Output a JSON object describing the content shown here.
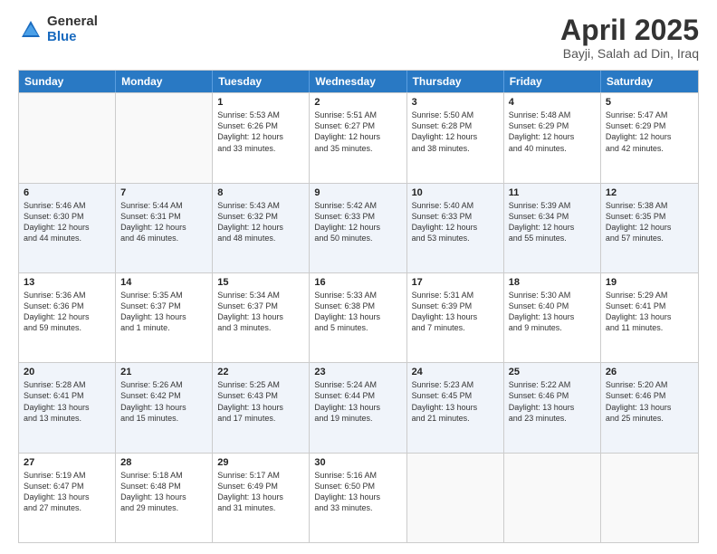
{
  "logo": {
    "general": "General",
    "blue": "Blue"
  },
  "header": {
    "title": "April 2025",
    "subtitle": "Bayji, Salah ad Din, Iraq"
  },
  "days": [
    "Sunday",
    "Monday",
    "Tuesday",
    "Wednesday",
    "Thursday",
    "Friday",
    "Saturday"
  ],
  "weeks": [
    [
      {
        "day": "",
        "lines": []
      },
      {
        "day": "",
        "lines": []
      },
      {
        "day": "1",
        "lines": [
          "Sunrise: 5:53 AM",
          "Sunset: 6:26 PM",
          "Daylight: 12 hours",
          "and 33 minutes."
        ]
      },
      {
        "day": "2",
        "lines": [
          "Sunrise: 5:51 AM",
          "Sunset: 6:27 PM",
          "Daylight: 12 hours",
          "and 35 minutes."
        ]
      },
      {
        "day": "3",
        "lines": [
          "Sunrise: 5:50 AM",
          "Sunset: 6:28 PM",
          "Daylight: 12 hours",
          "and 38 minutes."
        ]
      },
      {
        "day": "4",
        "lines": [
          "Sunrise: 5:48 AM",
          "Sunset: 6:29 PM",
          "Daylight: 12 hours",
          "and 40 minutes."
        ]
      },
      {
        "day": "5",
        "lines": [
          "Sunrise: 5:47 AM",
          "Sunset: 6:29 PM",
          "Daylight: 12 hours",
          "and 42 minutes."
        ]
      }
    ],
    [
      {
        "day": "6",
        "lines": [
          "Sunrise: 5:46 AM",
          "Sunset: 6:30 PM",
          "Daylight: 12 hours",
          "and 44 minutes."
        ]
      },
      {
        "day": "7",
        "lines": [
          "Sunrise: 5:44 AM",
          "Sunset: 6:31 PM",
          "Daylight: 12 hours",
          "and 46 minutes."
        ]
      },
      {
        "day": "8",
        "lines": [
          "Sunrise: 5:43 AM",
          "Sunset: 6:32 PM",
          "Daylight: 12 hours",
          "and 48 minutes."
        ]
      },
      {
        "day": "9",
        "lines": [
          "Sunrise: 5:42 AM",
          "Sunset: 6:33 PM",
          "Daylight: 12 hours",
          "and 50 minutes."
        ]
      },
      {
        "day": "10",
        "lines": [
          "Sunrise: 5:40 AM",
          "Sunset: 6:33 PM",
          "Daylight: 12 hours",
          "and 53 minutes."
        ]
      },
      {
        "day": "11",
        "lines": [
          "Sunrise: 5:39 AM",
          "Sunset: 6:34 PM",
          "Daylight: 12 hours",
          "and 55 minutes."
        ]
      },
      {
        "day": "12",
        "lines": [
          "Sunrise: 5:38 AM",
          "Sunset: 6:35 PM",
          "Daylight: 12 hours",
          "and 57 minutes."
        ]
      }
    ],
    [
      {
        "day": "13",
        "lines": [
          "Sunrise: 5:36 AM",
          "Sunset: 6:36 PM",
          "Daylight: 12 hours",
          "and 59 minutes."
        ]
      },
      {
        "day": "14",
        "lines": [
          "Sunrise: 5:35 AM",
          "Sunset: 6:37 PM",
          "Daylight: 13 hours",
          "and 1 minute."
        ]
      },
      {
        "day": "15",
        "lines": [
          "Sunrise: 5:34 AM",
          "Sunset: 6:37 PM",
          "Daylight: 13 hours",
          "and 3 minutes."
        ]
      },
      {
        "day": "16",
        "lines": [
          "Sunrise: 5:33 AM",
          "Sunset: 6:38 PM",
          "Daylight: 13 hours",
          "and 5 minutes."
        ]
      },
      {
        "day": "17",
        "lines": [
          "Sunrise: 5:31 AM",
          "Sunset: 6:39 PM",
          "Daylight: 13 hours",
          "and 7 minutes."
        ]
      },
      {
        "day": "18",
        "lines": [
          "Sunrise: 5:30 AM",
          "Sunset: 6:40 PM",
          "Daylight: 13 hours",
          "and 9 minutes."
        ]
      },
      {
        "day": "19",
        "lines": [
          "Sunrise: 5:29 AM",
          "Sunset: 6:41 PM",
          "Daylight: 13 hours",
          "and 11 minutes."
        ]
      }
    ],
    [
      {
        "day": "20",
        "lines": [
          "Sunrise: 5:28 AM",
          "Sunset: 6:41 PM",
          "Daylight: 13 hours",
          "and 13 minutes."
        ]
      },
      {
        "day": "21",
        "lines": [
          "Sunrise: 5:26 AM",
          "Sunset: 6:42 PM",
          "Daylight: 13 hours",
          "and 15 minutes."
        ]
      },
      {
        "day": "22",
        "lines": [
          "Sunrise: 5:25 AM",
          "Sunset: 6:43 PM",
          "Daylight: 13 hours",
          "and 17 minutes."
        ]
      },
      {
        "day": "23",
        "lines": [
          "Sunrise: 5:24 AM",
          "Sunset: 6:44 PM",
          "Daylight: 13 hours",
          "and 19 minutes."
        ]
      },
      {
        "day": "24",
        "lines": [
          "Sunrise: 5:23 AM",
          "Sunset: 6:45 PM",
          "Daylight: 13 hours",
          "and 21 minutes."
        ]
      },
      {
        "day": "25",
        "lines": [
          "Sunrise: 5:22 AM",
          "Sunset: 6:46 PM",
          "Daylight: 13 hours",
          "and 23 minutes."
        ]
      },
      {
        "day": "26",
        "lines": [
          "Sunrise: 5:20 AM",
          "Sunset: 6:46 PM",
          "Daylight: 13 hours",
          "and 25 minutes."
        ]
      }
    ],
    [
      {
        "day": "27",
        "lines": [
          "Sunrise: 5:19 AM",
          "Sunset: 6:47 PM",
          "Daylight: 13 hours",
          "and 27 minutes."
        ]
      },
      {
        "day": "28",
        "lines": [
          "Sunrise: 5:18 AM",
          "Sunset: 6:48 PM",
          "Daylight: 13 hours",
          "and 29 minutes."
        ]
      },
      {
        "day": "29",
        "lines": [
          "Sunrise: 5:17 AM",
          "Sunset: 6:49 PM",
          "Daylight: 13 hours",
          "and 31 minutes."
        ]
      },
      {
        "day": "30",
        "lines": [
          "Sunrise: 5:16 AM",
          "Sunset: 6:50 PM",
          "Daylight: 13 hours",
          "and 33 minutes."
        ]
      },
      {
        "day": "",
        "lines": []
      },
      {
        "day": "",
        "lines": []
      },
      {
        "day": "",
        "lines": []
      }
    ]
  ]
}
